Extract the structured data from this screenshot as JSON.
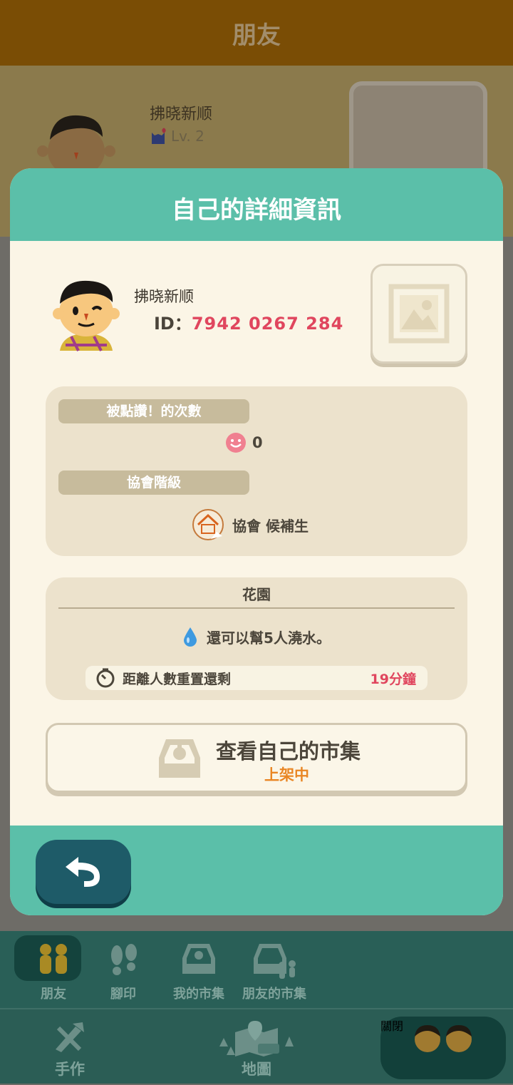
{
  "background": {
    "header_title": "朋友",
    "friend_name": "拂晓新顺",
    "friend_level": "Lv. 2"
  },
  "modal": {
    "title": "自己的詳細資訊",
    "self": {
      "name": "拂晓新顺",
      "id_label": "ID：",
      "id_value": "7942 0267 284"
    },
    "likes": {
      "label": "被點讚！的次數",
      "count": "0"
    },
    "rank": {
      "label": "協會階級",
      "value": "協會 候補生"
    },
    "garden": {
      "title": "花園",
      "water_text": "還可以幫5人澆水。",
      "reset_label": "距離人數重置還剩",
      "reset_value": "19分鐘"
    },
    "market": {
      "title": "查看自己的市集",
      "status": "上架中"
    },
    "back_icon": "undo-arrow-icon"
  },
  "tabs": [
    {
      "label": "朋友",
      "icon": "friends-icon",
      "active": true
    },
    {
      "label": "腳印",
      "icon": "footprints-icon"
    },
    {
      "label": "我的市集",
      "icon": "market-icon"
    },
    {
      "label": "朋友的市集",
      "icon": "friends-market-icon"
    }
  ],
  "nav": [
    {
      "label": "手作",
      "icon": "craft-tools-icon"
    },
    {
      "label": "地圖",
      "icon": "map-icon"
    },
    {
      "label": "關閉",
      "icon": "close-characters-icon"
    }
  ],
  "colors": {
    "teal": "#5bbfa9",
    "cream": "#fbf5e6",
    "accent_red": "#e0465e",
    "accent_orange": "#e98624",
    "header_brown": "#7a4d05"
  }
}
